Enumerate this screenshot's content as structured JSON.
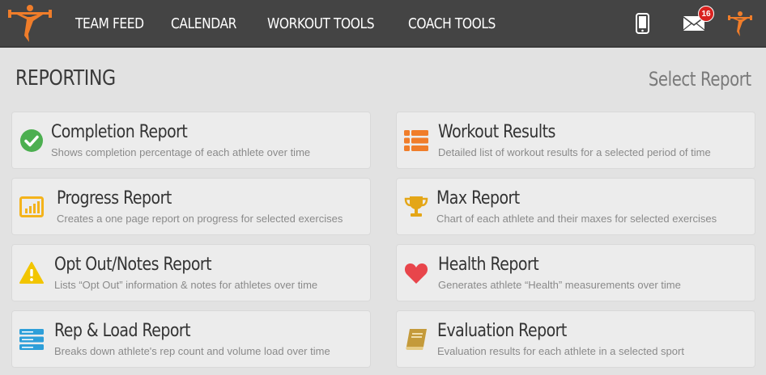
{
  "nav": {
    "items": [
      "TEAM FEED",
      "CALENDAR",
      "WORKOUT TOOLS",
      "COACH TOOLS"
    ],
    "notification_count": "16"
  },
  "page": {
    "title": "REPORTING",
    "action_label": "Select Report"
  },
  "colors": {
    "topbar": "#444444",
    "brand_orange": "#f07d2a",
    "badge_red": "#d9221f",
    "check_green": "#4caf50",
    "warning_yellow": "#f2c500",
    "heart_red": "#e8454b",
    "trophy_gold": "#e4a617",
    "book_brown": "#c49a3a",
    "list_blue": "#2e9fd9"
  },
  "reports": [
    {
      "title": "Completion Report",
      "desc": "Shows completion percentage of each athlete over time",
      "icon": "check-circle-icon"
    },
    {
      "title": "Workout Results",
      "desc": "Detailed list of workout results for a selected period of time",
      "icon": "list-icon"
    },
    {
      "title": "Progress Report",
      "desc": "Creates a one page report on progress for selected exercises",
      "icon": "bar-chart-icon"
    },
    {
      "title": "Max Report",
      "desc": "Chart of each athlete and their maxes for selected exercises",
      "icon": "trophy-icon"
    },
    {
      "title": "Opt Out/Notes Report",
      "desc": "Lists “Opt Out” information & notes for athletes over time",
      "icon": "warning-icon"
    },
    {
      "title": "Health Report",
      "desc": "Generates athlete “Health” measurements over time",
      "icon": "heart-icon"
    },
    {
      "title": "Rep & Load Report",
      "desc": "Breaks down athlete's rep count and volume load over time",
      "icon": "server-icon"
    },
    {
      "title": "Evaluation Report",
      "desc": "Evaluation results for each athlete in a selected sport",
      "icon": "book-icon"
    }
  ]
}
